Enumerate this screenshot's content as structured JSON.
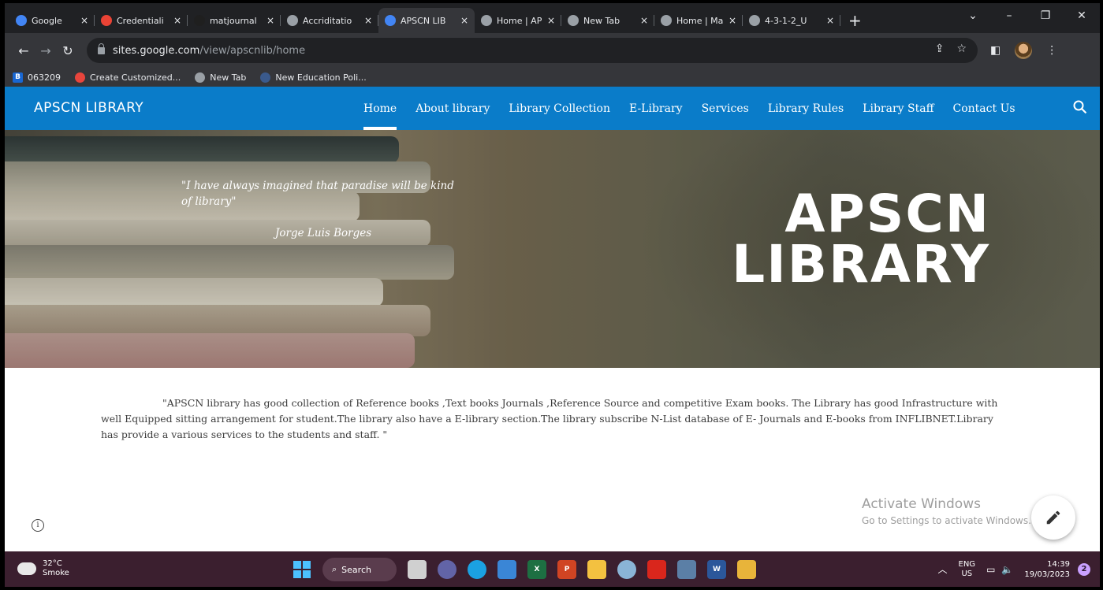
{
  "browser": {
    "tabs": [
      {
        "label": "Google",
        "icon": "google-icon",
        "color": "#4285f4",
        "active": false
      },
      {
        "label": "Credentiali",
        "icon": "gmail-icon",
        "color": "#ea4335",
        "active": false
      },
      {
        "label": "matjournal",
        "icon": "pkp-icon",
        "color": "#1f1f1f",
        "active": false
      },
      {
        "label": "Accriditatio",
        "icon": "globe-icon",
        "color": "#9aa0a6",
        "active": false
      },
      {
        "label": "APSCN LIB",
        "icon": "sites-icon",
        "color": "#4285f4",
        "active": true
      },
      {
        "label": "Home | AP",
        "icon": "globe-icon",
        "color": "#9aa0a6",
        "active": false
      },
      {
        "label": "New Tab",
        "icon": "chrome-icon",
        "color": "#9aa0a6",
        "active": false
      },
      {
        "label": "Home | Ma",
        "icon": "globe-icon",
        "color": "#9aa0a6",
        "active": false
      },
      {
        "label": "4-3-1-2_U",
        "icon": "globe-icon",
        "color": "#9aa0a6",
        "active": false
      }
    ],
    "close_glyph": "×",
    "new_tab_glyph": "+",
    "url_host": "sites.google.com",
    "url_path": "/view/apscnlib/home",
    "bookmarks": [
      {
        "label": "063209",
        "icon": "b-icon",
        "glyph": "B",
        "color": "#1967d2"
      },
      {
        "label": "Create Customized...",
        "icon": "canva-icon",
        "glyph": "",
        "color": "#e8453c"
      },
      {
        "label": "New Tab",
        "icon": "globe-icon",
        "glyph": "",
        "color": "#9aa0a6"
      },
      {
        "label": "New Education Poli...",
        "icon": "edu-icon",
        "glyph": "",
        "color": "#3a5a8c"
      }
    ]
  },
  "site": {
    "brand": "APSCN LIBRARY",
    "nav": [
      "Home",
      "About library",
      "Library Collection",
      "E-Library",
      "Services",
      "Library Rules",
      "Library Staff",
      "Contact Us"
    ],
    "hero": {
      "quote": "\"I have always imagined that paradise will be kind of library\"",
      "author": "Jorge Luis Borges",
      "title_line1": "APSCN",
      "title_line2": "LIBRARY"
    },
    "description": "\"APSCN library has good collection of Reference books ,Text books Journals ,Reference Source and competitive Exam books.  The Library has good Infrastructure  with well Equipped sitting arrangement for student.The library also have a E-library section.The library subscribe N-List database of E- Journals and E-books from INFLIBNET.Library has provide a various services to the students and staff.  \"",
    "info_glyph": "i"
  },
  "watermark": {
    "line1": "Activate Windows",
    "line2": "Go to Settings to activate Windows."
  },
  "taskbar": {
    "temperature": "32°C",
    "weather": "Smoke",
    "search_label": "Search",
    "apps": [
      {
        "name": "taskview-icon",
        "glyph": "",
        "color": "#d0d0d0"
      },
      {
        "name": "chat-icon",
        "glyph": "",
        "color": "#6264a7"
      },
      {
        "name": "edge-icon",
        "glyph": "",
        "color": "#1ba1e2"
      },
      {
        "name": "store-icon",
        "glyph": "",
        "color": "#3a86d6"
      },
      {
        "name": "excel-icon",
        "glyph": "X",
        "color": "#1d6f42"
      },
      {
        "name": "powerpoint-icon",
        "glyph": "P",
        "color": "#d04423"
      },
      {
        "name": "explorer-icon",
        "glyph": "",
        "color": "#f3c140"
      },
      {
        "name": "settings-icon",
        "glyph": "",
        "color": "#8ab4d6"
      },
      {
        "name": "acrobat-icon",
        "glyph": "",
        "color": "#d9261c"
      },
      {
        "name": "calculator-icon",
        "glyph": "",
        "color": "#5b7fa6"
      },
      {
        "name": "word-icon",
        "glyph": "W",
        "color": "#2b579a"
      },
      {
        "name": "chrome-icon",
        "glyph": "",
        "color": "#e8b43a"
      }
    ],
    "lang_line1": "ENG",
    "lang_line2": "US",
    "time": "14:39",
    "date": "19/03/2023",
    "notifications": "2"
  }
}
